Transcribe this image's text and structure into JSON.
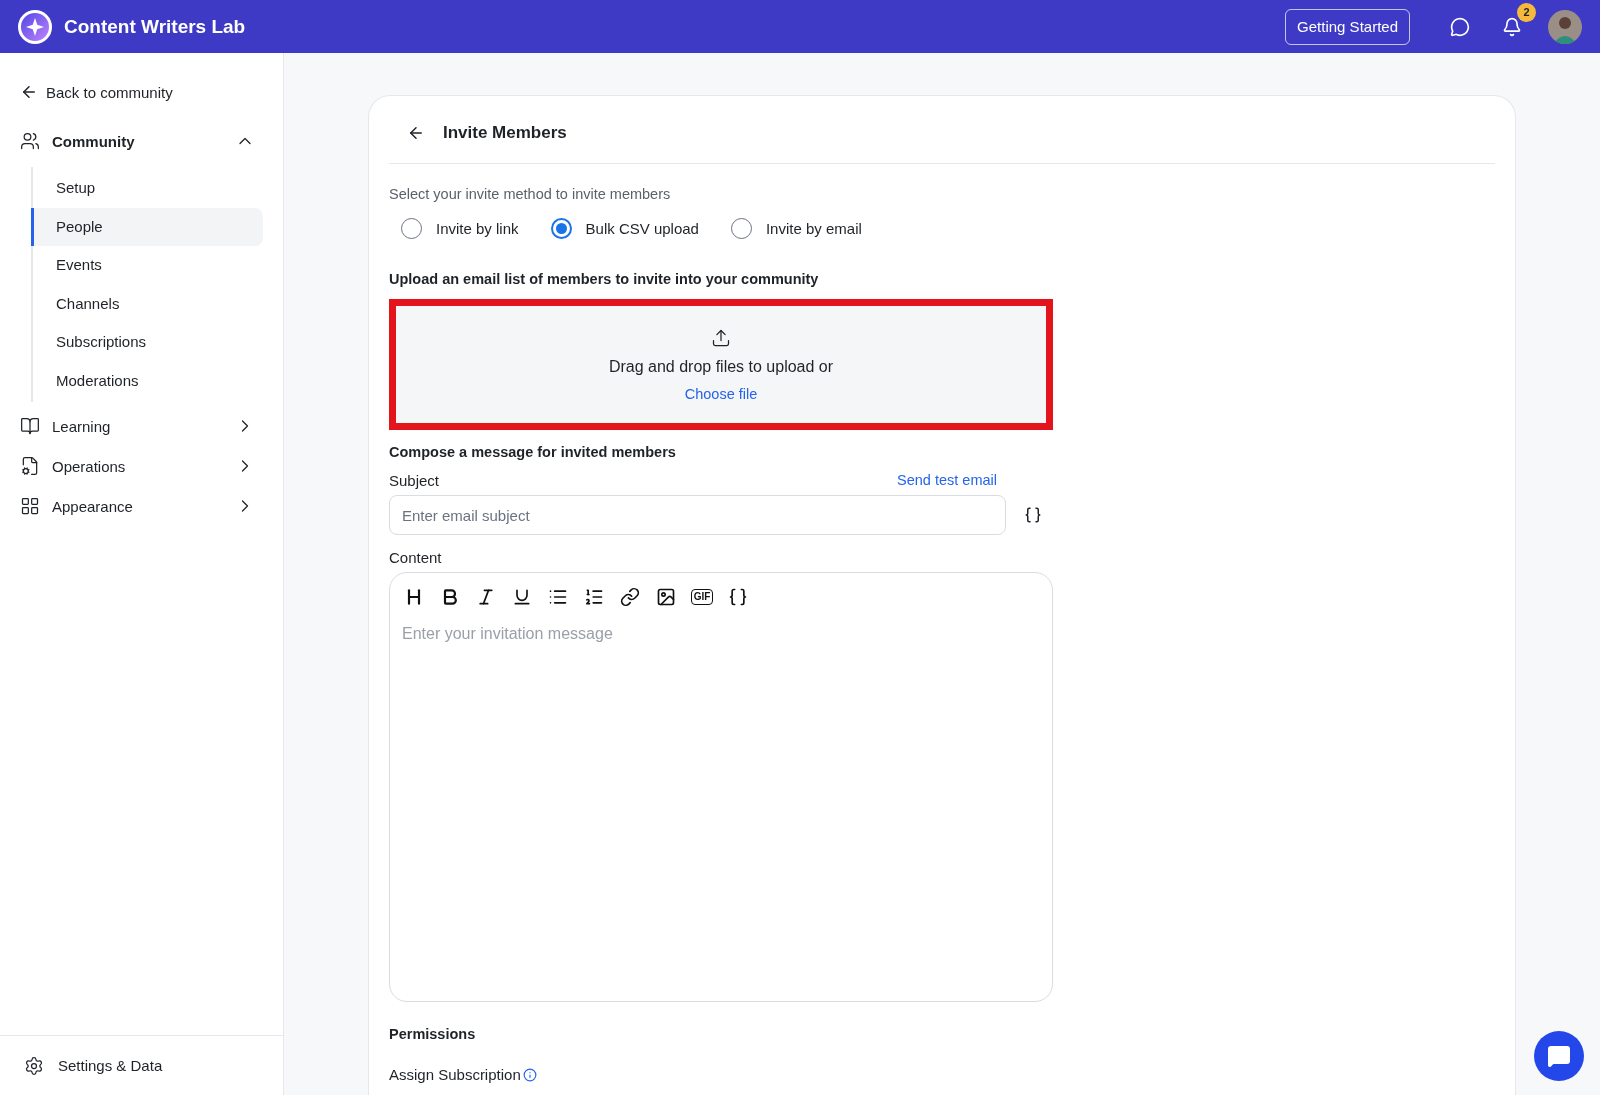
{
  "header": {
    "title": "Content Writers Lab",
    "button": "Getting Started",
    "notification_count": "2"
  },
  "sidebar": {
    "back": "Back to community",
    "sections": [
      {
        "label": "Community",
        "expanded": true,
        "children": [
          {
            "label": "Setup",
            "selected": false
          },
          {
            "label": "People",
            "selected": true
          },
          {
            "label": "Events",
            "selected": false
          },
          {
            "label": "Channels",
            "selected": false
          },
          {
            "label": "Subscriptions",
            "selected": false
          },
          {
            "label": "Moderations",
            "selected": false
          }
        ]
      },
      {
        "label": "Learning",
        "expanded": false
      },
      {
        "label": "Operations",
        "expanded": false
      },
      {
        "label": "Appearance",
        "expanded": false
      }
    ],
    "footer": "Settings & Data"
  },
  "main": {
    "title": "Invite Members",
    "method_prompt": "Select your invite method to invite members",
    "methods": [
      {
        "label": "Invite by link",
        "selected": false
      },
      {
        "label": "Bulk CSV upload",
        "selected": true
      },
      {
        "label": "Invite by email",
        "selected": false
      }
    ],
    "upload_heading": "Upload an email list of members to invite into your community",
    "dropzone": {
      "text": "Drag and drop files to upload or",
      "link": "Choose file"
    },
    "compose_heading": "Compose a message for invited members",
    "subject": {
      "label": "Subject",
      "action": "Send test email",
      "placeholder": "Enter email subject"
    },
    "content": {
      "label": "Content",
      "placeholder": "Enter your invitation message",
      "tools": [
        {
          "kind": "heading"
        },
        {
          "kind": "bold"
        },
        {
          "kind": "italic"
        },
        {
          "kind": "underline"
        },
        {
          "kind": "bullets"
        },
        {
          "kind": "numbers"
        },
        {
          "kind": "link"
        },
        {
          "kind": "image"
        },
        {
          "kind": "gif",
          "label": "GIF"
        },
        {
          "kind": "variable"
        }
      ]
    },
    "permissions": {
      "heading": "Permissions",
      "field": "Assign Subscription"
    }
  }
}
